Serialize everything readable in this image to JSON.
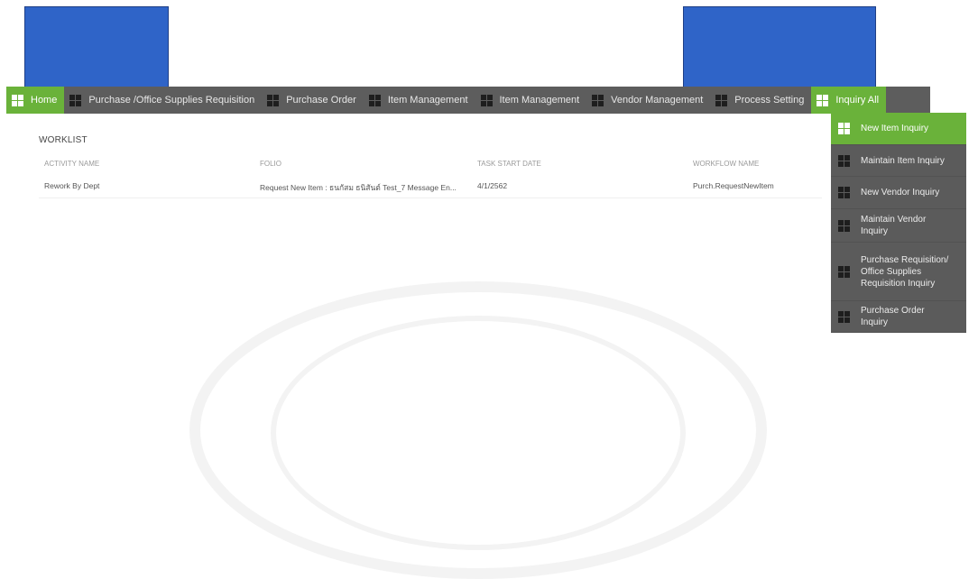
{
  "nav": {
    "items": [
      {
        "label": "Home",
        "active": true
      },
      {
        "label": "Purchase /Office Supplies Requisition"
      },
      {
        "label": "Purchase Order"
      },
      {
        "label": "Item Management"
      },
      {
        "label": "Item Management"
      },
      {
        "label": "Vendor Management"
      },
      {
        "label": "Process Setting"
      },
      {
        "label": "Inquiry All"
      }
    ]
  },
  "worklist": {
    "title": "WORKLIST",
    "columns": [
      "ACTIVITY NAME",
      "FOLIO",
      "TASK START DATE",
      "WORKFLOW NAME"
    ],
    "rows": [
      {
        "activity": "Rework By Dept",
        "folio": "Request New Item : ธนกัสม ธนิสันต์ Test_7 Message En...",
        "date": "4/1/2562",
        "workflow": "Purch.RequestNewItem"
      }
    ]
  },
  "dropdown": {
    "items": [
      {
        "label": "New Item Inquiry",
        "active": true
      },
      {
        "label": "Maintain Item Inquiry"
      },
      {
        "label": "New Vendor Inquiry"
      },
      {
        "label": "Maintain Vendor Inquiry"
      },
      {
        "label": "Purchase Requisition/ Office Supplies Requisition Inquiry"
      },
      {
        "label": "Purchase Order Inquiry"
      }
    ]
  },
  "colors": {
    "nav_bg": "#5d5d5d",
    "active": "#6ab23a",
    "redaction": "#2f64c8"
  }
}
